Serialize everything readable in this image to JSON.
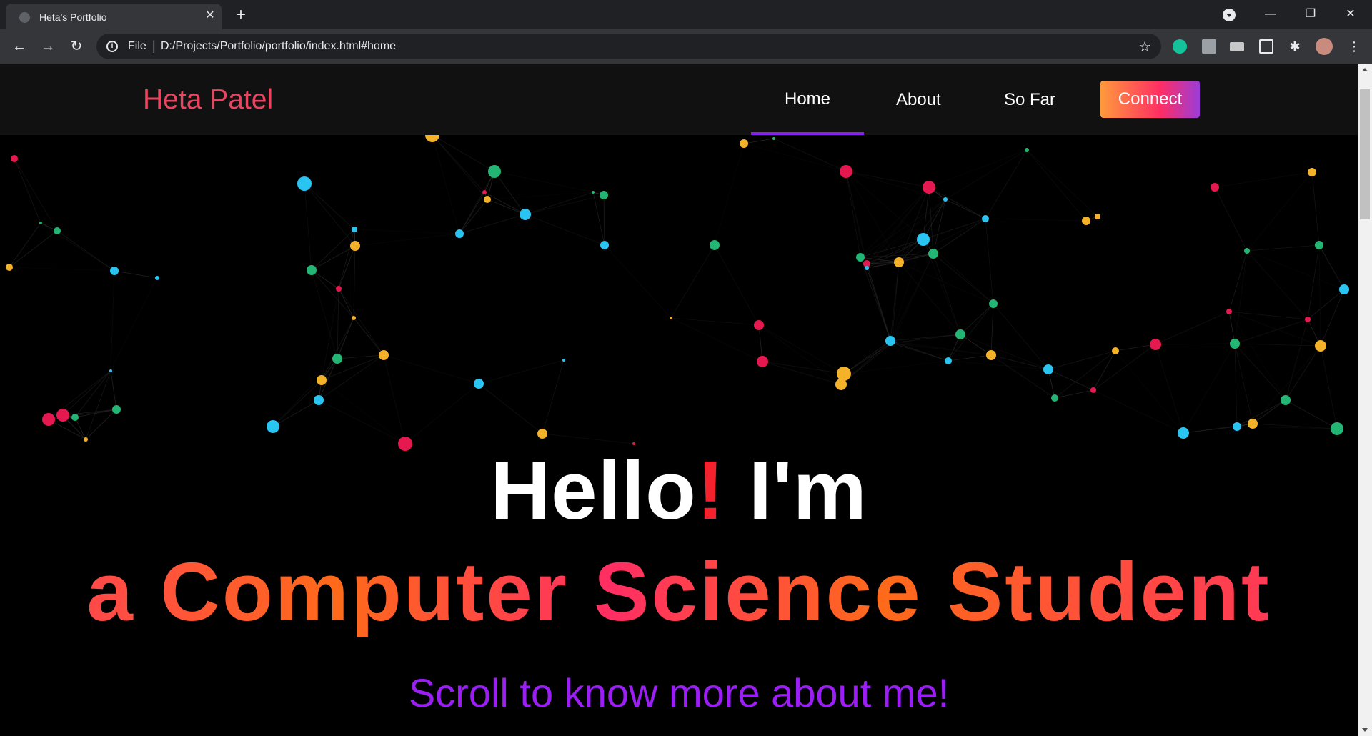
{
  "browser": {
    "tab_title": "Heta's Portfolio",
    "tab_close": "✕",
    "new_tab": "+",
    "url_scheme": "File",
    "url_separator": "|",
    "url": "D:/Projects/Portfolio/portfolio/index.html#home",
    "back_icon": "←",
    "forward_icon": "→",
    "reload_icon": "↻",
    "star_icon": "☆",
    "minimize": "—",
    "restore": "❐",
    "close": "✕"
  },
  "site": {
    "brand": "Heta Patel",
    "nav": {
      "home": "Home",
      "about": "About",
      "so_far": "So Far",
      "connect": "Connect"
    },
    "hero": {
      "hello": "Hello",
      "bang": "!",
      "im": " I'm",
      "role": "a Computer Science Student",
      "subtitle": "Scroll to know more about me!"
    }
  },
  "colors": {
    "brand": "#e94560",
    "accent_purple": "#8a1df0",
    "particle_palette": [
      "#e5194f",
      "#f4b12a",
      "#23b573",
      "#29c4f2"
    ]
  }
}
